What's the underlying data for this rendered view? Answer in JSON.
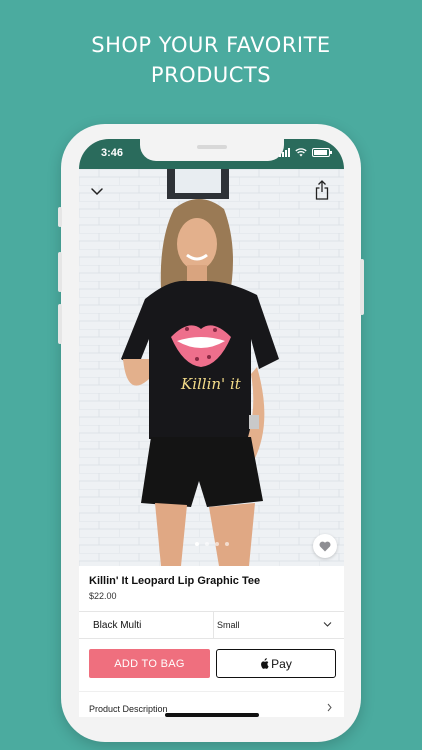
{
  "headline": {
    "line1": "SHOP YOUR FAVORITE",
    "line2": "PRODUCTS"
  },
  "status_bar": {
    "time": "3:46"
  },
  "gallery": {
    "image_count": 4,
    "active_index": 0,
    "image_description": "model wearing black tee with pink leopard lips graphic"
  },
  "product": {
    "title": "Killin' It Leopard Lip Graphic Tee",
    "price": "$22.00",
    "graphic_text": "Killin' it"
  },
  "variants": {
    "color": "Black Multi",
    "size": "Small"
  },
  "actions": {
    "add_to_bag_label": "ADD TO BAG",
    "apple_pay_label": "Pay"
  },
  "sections": {
    "description_label": "Product Description"
  },
  "colors": {
    "background": "#4bab9f",
    "status_bar": "#2a6b5c",
    "add_to_bag": "#ef6f7e"
  }
}
